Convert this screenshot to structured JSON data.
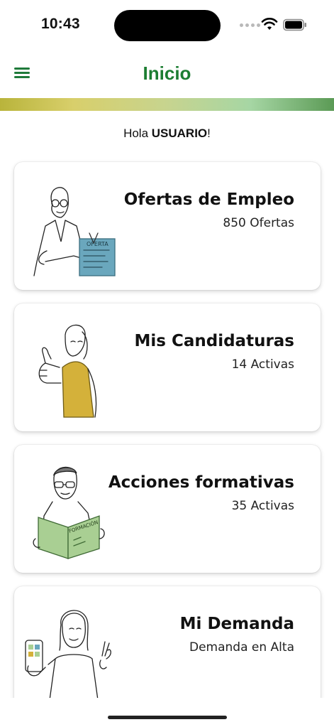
{
  "status_bar": {
    "time": "10:43",
    "icons": [
      "cellular-dots-icon",
      "wifi-icon",
      "battery-icon"
    ]
  },
  "header": {
    "title": "Inicio",
    "menu_icon": "hamburger-menu-icon"
  },
  "colors": {
    "brand_green": "#1c7d32",
    "text": "#111111",
    "card_bg": "#ffffff"
  },
  "greeting": {
    "prefix": "Hola ",
    "user": "USUARIO",
    "suffix": "!"
  },
  "cards": [
    {
      "title": "Ofertas de Empleo",
      "subtitle": "850 Ofertas",
      "illustration": "person-holding-job-offer-illustration",
      "illustration_text": "OFERTA"
    },
    {
      "title": "Mis Candidaturas",
      "subtitle": "14 Activas",
      "illustration": "person-thumbs-up-illustration"
    },
    {
      "title": "Acciones formativas",
      "subtitle": "35 Activas",
      "illustration": "person-reading-training-book-illustration",
      "illustration_text": "FORMACIÓN"
    },
    {
      "title": "Mi Demanda",
      "subtitle": "Demanda en Alta",
      "illustration": "person-holding-phone-illustration"
    }
  ]
}
